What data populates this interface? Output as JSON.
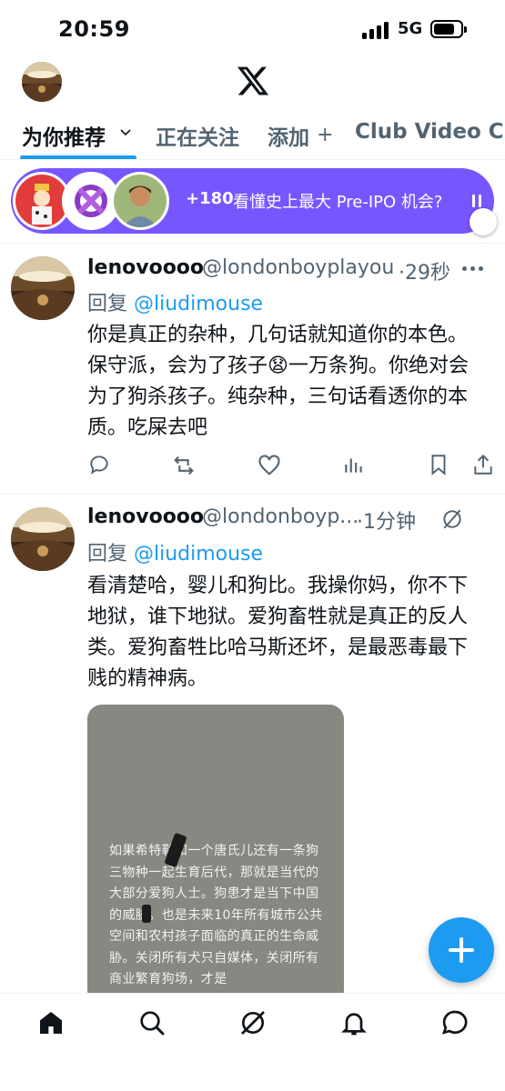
{
  "status_bar": {
    "time": "20:59",
    "network": "5G"
  },
  "header": {
    "logo_icon": "x-logo-icon",
    "avatar_icon": "profile-avatar"
  },
  "tabs": [
    {
      "label": "为你推荐",
      "active": true
    },
    {
      "label": "正在关注",
      "active": false
    },
    {
      "label": "添加",
      "active": false
    },
    {
      "label": "Club Video Ch",
      "active": false
    }
  ],
  "spaces_bar": {
    "count": "+180",
    "title": "看懂史上最大 Pre-IPO 机会?",
    "accent_color": "#7856ff"
  },
  "tweets": [
    {
      "name": "lenovoooo",
      "handle": "@londonboyplayou",
      "time": "·29秒",
      "reply_prefix": "回复 ",
      "reply_to": "@liudimouse",
      "text_before_emoji": "你是真正的杂种，几句话就知道你的本色。保守派，会为了孩子",
      "emoji": "😧",
      "text_after_emoji": "一万条狗。你绝对会为了狗杀孩子。纯杂种，三句话看透你的本质。吃屎去吧"
    },
    {
      "name": "lenovoooo",
      "handle": "@londonboyp...",
      "time": "·1分钟",
      "reply_prefix": "回复 ",
      "reply_to": "@liudimouse",
      "text": "看清楚哈，婴儿和狗比。我操你妈，你不下地狱，谁下地狱。爱狗畜牲就是真正的反人类。爱狗畜牲比哈马斯还坏，是最恶毒最下贱的精神病。",
      "media_text": "如果希特勒和一个唐氏儿还有一条狗三物种一起生育后代，那就是当代的大部分爱狗人士。狗患才是当下中国的威胁。也是未来10年所有城市公共空间和农村孩子面临的真正的生命威胁。关闭所有犬只自媒体，关闭所有商业繁育狗场，才是"
    }
  ],
  "bottom_nav": [
    "home-icon",
    "search-icon",
    "grok-icon",
    "notifications-icon",
    "messages-icon"
  ],
  "colors": {
    "accent": "#1d9bf0",
    "text": "#0f1419",
    "secondary": "#536471"
  }
}
